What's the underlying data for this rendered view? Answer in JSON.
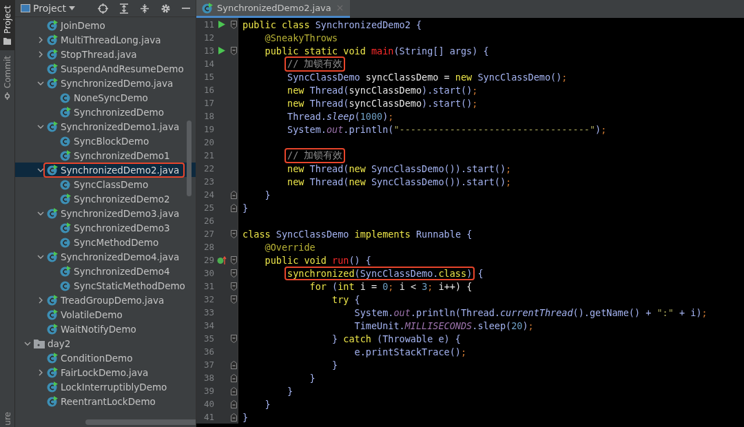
{
  "tool_strip": [
    {
      "label": "Project",
      "selected": true,
      "kind": "folder"
    },
    {
      "label": "Commit",
      "selected": false,
      "kind": "commit"
    },
    {
      "label": "ure",
      "selected": false,
      "kind": "none"
    }
  ],
  "sidebar": {
    "title": "Project",
    "tree": [
      {
        "kind": "group",
        "children": [
          {
            "kind": "class",
            "label": "JoinDemo",
            "runnable": true,
            "selected": false
          },
          {
            "kind": "class",
            "label": "MultiThreadLong.java",
            "runnable": true,
            "expanded": false,
            "selected": false
          },
          {
            "kind": "class",
            "label": "StopThread.java",
            "runnable": true,
            "expanded": false,
            "selected": false
          },
          {
            "kind": "class",
            "label": "SuspendAndResumeDemo",
            "runnable": true,
            "selected": false
          },
          {
            "kind": "class",
            "label": "SynchronizedDemo.java",
            "runnable": true,
            "expanded": true,
            "selected": false,
            "children": [
              {
                "kind": "class",
                "label": "NoneSyncDemo",
                "runnable": false,
                "selected": false
              },
              {
                "kind": "class",
                "label": "SynchronizedDemo",
                "runnable": true,
                "selected": false
              }
            ]
          },
          {
            "kind": "class",
            "label": "SynchronizedDemo1.java",
            "runnable": true,
            "expanded": true,
            "selected": false,
            "children": [
              {
                "kind": "class",
                "label": "SyncBlockDemo",
                "runnable": false,
                "selected": false
              },
              {
                "kind": "class",
                "label": "SynchronizedDemo1",
                "runnable": true,
                "selected": false
              }
            ]
          },
          {
            "kind": "class",
            "label": "SynchronizedDemo2.java",
            "runnable": true,
            "expanded": true,
            "selected": true,
            "boxed": true,
            "children": [
              {
                "kind": "class",
                "label": "SyncClassDemo",
                "runnable": false,
                "selected": false
              },
              {
                "kind": "class",
                "label": "SynchronizedDemo2",
                "runnable": true,
                "selected": false
              }
            ]
          },
          {
            "kind": "class",
            "label": "SynchronizedDemo3.java",
            "runnable": true,
            "expanded": true,
            "selected": false,
            "children": [
              {
                "kind": "class",
                "label": "SynchronizedDemo3",
                "runnable": true,
                "selected": false
              },
              {
                "kind": "class",
                "label": "SyncMethodDemo",
                "runnable": false,
                "selected": false
              }
            ]
          },
          {
            "kind": "class",
            "label": "SynchronizedDemo4.java",
            "runnable": true,
            "expanded": true,
            "selected": false,
            "children": [
              {
                "kind": "class",
                "label": "SynchronizedDemo4",
                "runnable": true,
                "selected": false
              },
              {
                "kind": "class",
                "label": "SyncStaticMethodDemo",
                "runnable": false,
                "selected": false
              }
            ]
          },
          {
            "kind": "class",
            "label": "TreadGroupDemo.java",
            "runnable": true,
            "expanded": false,
            "selected": false
          },
          {
            "kind": "class",
            "label": "VolatileDemo",
            "runnable": true,
            "selected": false
          },
          {
            "kind": "class",
            "label": "WaitNotifyDemo",
            "runnable": true,
            "selected": false
          }
        ]
      },
      {
        "kind": "folder",
        "label": "day2",
        "expanded": true,
        "selected": false,
        "children": [
          {
            "kind": "class",
            "label": "ConditionDemo",
            "runnable": true,
            "selected": false
          },
          {
            "kind": "class",
            "label": "FairLockDemo.java",
            "runnable": true,
            "expanded": false,
            "selected": false
          },
          {
            "kind": "class",
            "label": "LockInterruptiblyDemo",
            "runnable": true,
            "selected": false
          },
          {
            "kind": "class",
            "label": "ReentrantLockDemo",
            "runnable": true,
            "selected": false
          }
        ]
      }
    ]
  },
  "editor": {
    "tabs": [
      {
        "label": "SynchronizedDemo2.java",
        "selected": true
      }
    ],
    "lines": [
      {
        "number": "11",
        "markers": [
          {
            "kind": "run"
          },
          {
            "kind": "fold-start"
          }
        ],
        "tokens": [
          {
            "kind": "kw",
            "t": "public class "
          },
          {
            "kind": "type",
            "t": "SynchronizedDemo2 {"
          }
        ],
        "children": [
          {
            "number": "12",
            "tokens": [
              {
                "kind": "annot",
                "t": "@SneakyThrows"
              }
            ]
          },
          {
            "number": "13",
            "markers": [
              {
                "kind": "run"
              },
              {
                "kind": "fold-start"
              }
            ],
            "tokens": [
              {
                "kind": "kw",
                "t": "public static void "
              },
              {
                "kind": "decl",
                "t": "main"
              },
              {
                "kind": "type",
                "t": "(String[] args) {"
              }
            ],
            "children": [
              {
                "number": "14",
                "tokens": [
                  {
                    "kind": "comment",
                    "t": "// 加锁有效",
                    "boxed": true
                  }
                ]
              },
              {
                "number": "15",
                "tokens": [
                  {
                    "kind": "type",
                    "t": "SyncClassDemo"
                  },
                  {
                    "kind": "plain",
                    "t": " syncClassDemo = "
                  },
                  {
                    "kind": "kw",
                    "t": "new "
                  },
                  {
                    "kind": "type",
                    "t": "SyncClassDemo()"
                  },
                  {
                    "kind": "punct",
                    "t": ";"
                  }
                ]
              },
              {
                "number": "16",
                "tokens": [
                  {
                    "kind": "kw",
                    "t": "new "
                  },
                  {
                    "kind": "type",
                    "t": "Thread("
                  },
                  {
                    "kind": "plain",
                    "t": "syncClassDemo"
                  },
                  {
                    "kind": "type",
                    "t": ").start()"
                  },
                  {
                    "kind": "punct",
                    "t": ";"
                  }
                ]
              },
              {
                "number": "17",
                "tokens": [
                  {
                    "kind": "kw",
                    "t": "new "
                  },
                  {
                    "kind": "type",
                    "t": "Thread("
                  },
                  {
                    "kind": "plain",
                    "t": "syncClassDemo"
                  },
                  {
                    "kind": "type",
                    "t": ").start()"
                  },
                  {
                    "kind": "punct",
                    "t": ";"
                  }
                ]
              },
              {
                "number": "18",
                "tokens": [
                  {
                    "kind": "type",
                    "t": "Thread."
                  },
                  {
                    "kind": "static",
                    "t": "sleep"
                  },
                  {
                    "kind": "type",
                    "t": "("
                  },
                  {
                    "kind": "num",
                    "t": "1000"
                  },
                  {
                    "kind": "type",
                    "t": ")"
                  },
                  {
                    "kind": "punct",
                    "t": ";"
                  }
                ]
              },
              {
                "number": "19",
                "tokens": [
                  {
                    "kind": "type",
                    "t": "System."
                  },
                  {
                    "kind": "field",
                    "t": "out"
                  },
                  {
                    "kind": "type",
                    "t": ".println("
                  },
                  {
                    "kind": "str",
                    "t": "\"----------------------------------\""
                  },
                  {
                    "kind": "type",
                    "t": ")"
                  },
                  {
                    "kind": "punct",
                    "t": ";"
                  }
                ]
              },
              {
                "number": "20"
              },
              {
                "number": "21",
                "tokens": [
                  {
                    "kind": "comment",
                    "t": "// 加锁有效",
                    "boxed": true
                  }
                ]
              },
              {
                "number": "22",
                "tokens": [
                  {
                    "kind": "kw",
                    "t": "new "
                  },
                  {
                    "kind": "type",
                    "t": "Thread("
                  },
                  {
                    "kind": "kw",
                    "t": "new "
                  },
                  {
                    "kind": "type",
                    "t": "SyncClassDemo()).start()"
                  },
                  {
                    "kind": "punct",
                    "t": ";"
                  }
                ]
              },
              {
                "number": "23",
                "tokens": [
                  {
                    "kind": "kw",
                    "t": "new "
                  },
                  {
                    "kind": "type",
                    "t": "Thread("
                  },
                  {
                    "kind": "kw",
                    "t": "new "
                  },
                  {
                    "kind": "type",
                    "t": "SyncClassDemo()).start()"
                  },
                  {
                    "kind": "punct",
                    "t": ";"
                  }
                ]
              }
            ]
          },
          {
            "number": "24",
            "markers": [
              {
                "kind": "fold-end"
              }
            ],
            "tokens": [
              {
                "kind": "type",
                "t": "}"
              }
            ]
          }
        ]
      },
      {
        "number": "25",
        "markers": [
          {
            "kind": "fold-end"
          }
        ],
        "tokens": [
          {
            "kind": "type",
            "t": "}"
          }
        ]
      },
      {
        "number": "26"
      },
      {
        "number": "27",
        "markers": [
          {
            "kind": "fold-start"
          }
        ],
        "tokens": [
          {
            "kind": "kw",
            "t": "class "
          },
          {
            "kind": "type",
            "t": "SyncClassDemo "
          },
          {
            "kind": "kw",
            "t": "implements "
          },
          {
            "kind": "type",
            "t": "Runnable {"
          }
        ],
        "children": [
          {
            "number": "28",
            "tokens": [
              {
                "kind": "annot",
                "t": "@Override"
              }
            ]
          },
          {
            "number": "29",
            "markers": [
              {
                "kind": "override"
              },
              {
                "kind": "fold-start"
              }
            ],
            "tokens": [
              {
                "kind": "kw",
                "t": "public void "
              },
              {
                "kind": "decl",
                "t": "run"
              },
              {
                "kind": "type",
                "t": "() {"
              }
            ],
            "children": [
              {
                "number": "30",
                "markers": [
                  {
                    "kind": "fold-start"
                  }
                ],
                "tokens": [
                  {
                    "kind": "kw",
                    "t": "synchronized",
                    "boxed": true
                  },
                  {
                    "kind": "type",
                    "t": "(SyncClassDemo.",
                    "boxed": true
                  },
                  {
                    "kind": "kw",
                    "t": "class",
                    "boxed": true
                  },
                  {
                    "kind": "type",
                    "t": ")",
                    "boxed": true
                  },
                  {
                    "kind": "type",
                    "t": " {"
                  }
                ],
                "children": [
                  {
                    "number": "31",
                    "markers": [
                      {
                        "kind": "fold-start"
                      }
                    ],
                    "tokens": [
                      {
                        "kind": "kw",
                        "t": "for "
                      },
                      {
                        "kind": "type",
                        "t": "("
                      },
                      {
                        "kind": "kw",
                        "t": "int "
                      },
                      {
                        "kind": "plain",
                        "t": "i = "
                      },
                      {
                        "kind": "num",
                        "t": "0"
                      },
                      {
                        "kind": "punct",
                        "t": ";"
                      },
                      {
                        "kind": "plain",
                        "t": " i < "
                      },
                      {
                        "kind": "num",
                        "t": "3"
                      },
                      {
                        "kind": "punct",
                        "t": ";"
                      },
                      {
                        "kind": "plain",
                        "t": " i++) {"
                      }
                    ],
                    "children": [
                      {
                        "number": "32",
                        "markers": [
                          {
                            "kind": "fold-start"
                          }
                        ],
                        "tokens": [
                          {
                            "kind": "kw",
                            "t": "try "
                          },
                          {
                            "kind": "type",
                            "t": "{"
                          }
                        ],
                        "children": [
                          {
                            "number": "33",
                            "tokens": [
                              {
                                "kind": "type",
                                "t": "System."
                              },
                              {
                                "kind": "field",
                                "t": "out"
                              },
                              {
                                "kind": "type",
                                "t": ".println(Thread."
                              },
                              {
                                "kind": "static",
                                "t": "currentThread"
                              },
                              {
                                "kind": "type",
                                "t": "().getName() + "
                              },
                              {
                                "kind": "str",
                                "t": "\":\""
                              },
                              {
                                "kind": "type",
                                "t": " + i)"
                              },
                              {
                                "kind": "punct",
                                "t": ";"
                              }
                            ]
                          },
                          {
                            "number": "34",
                            "tokens": [
                              {
                                "kind": "type",
                                "t": "TimeUnit."
                              },
                              {
                                "kind": "field",
                                "t": "MILLISECONDS"
                              },
                              {
                                "kind": "type",
                                "t": ".sleep("
                              },
                              {
                                "kind": "num",
                                "t": "20"
                              },
                              {
                                "kind": "type",
                                "t": ")"
                              },
                              {
                                "kind": "punct",
                                "t": ";"
                              }
                            ]
                          }
                        ]
                      },
                      {
                        "number": "35",
                        "markers": [
                          {
                            "kind": "fold-start"
                          }
                        ],
                        "tokens": [
                          {
                            "kind": "type",
                            "t": "} "
                          },
                          {
                            "kind": "kw",
                            "t": "catch "
                          },
                          {
                            "kind": "type",
                            "t": "(Throwable e) {"
                          }
                        ],
                        "children": [
                          {
                            "number": "36",
                            "tokens": [
                              {
                                "kind": "type",
                                "t": "e.printStackTrace()"
                              },
                              {
                                "kind": "punct",
                                "t": ";"
                              }
                            ]
                          }
                        ]
                      },
                      {
                        "number": "37",
                        "markers": [
                          {
                            "kind": "fold-end"
                          }
                        ],
                        "tokens": [
                          {
                            "kind": "type",
                            "t": "}"
                          }
                        ]
                      }
                    ]
                  },
                  {
                    "number": "38",
                    "markers": [
                      {
                        "kind": "fold-end"
                      }
                    ],
                    "tokens": [
                      {
                        "kind": "type",
                        "t": "}"
                      }
                    ]
                  }
                ]
              },
              {
                "number": "39",
                "markers": [
                  {
                    "kind": "fold-end"
                  }
                ],
                "tokens": [
                  {
                    "kind": "type",
                    "t": "}"
                  }
                ]
              }
            ]
          },
          {
            "number": "40",
            "markers": [
              {
                "kind": "fold-end"
              }
            ],
            "tokens": [
              {
                "kind": "type",
                "t": "}"
              }
            ]
          }
        ]
      },
      {
        "number": "41",
        "markers": [
          {
            "kind": "fold-end"
          }
        ],
        "tokens": [
          {
            "kind": "type",
            "t": "}"
          }
        ]
      }
    ]
  }
}
